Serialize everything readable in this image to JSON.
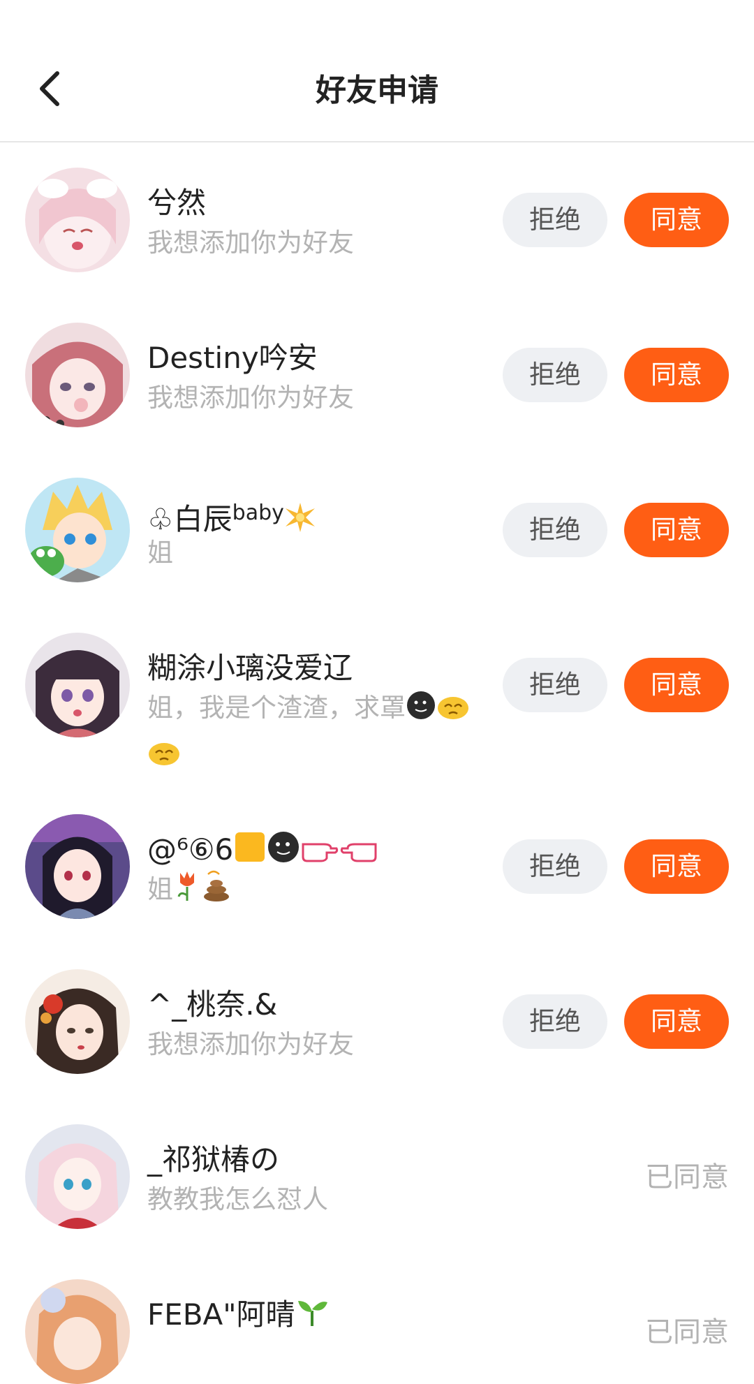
{
  "header": {
    "title": "好友申请",
    "back_icon": "chevron-left-icon"
  },
  "colors": {
    "accent": "#ff5e14",
    "reject_bg": "#eef0f3",
    "muted_text": "#b3b3b3"
  },
  "requests": [
    {
      "name": "兮然",
      "message": "我想添加你为好友",
      "reject_label": "拒绝",
      "accept_label": "同意"
    },
    {
      "name": "Destiny吟安",
      "message": "我想添加你为好友",
      "reject_label": "拒绝",
      "accept_label": "同意"
    },
    {
      "name_prefix": "♧白辰",
      "name_sup": "baby",
      "name_emoji": "star-burst-emoji",
      "message": "姐",
      "reject_label": "拒绝",
      "accept_label": "同意"
    },
    {
      "name": "糊涂小璃没爱辽",
      "message": "姐，我是个渣渣，求罩",
      "message_emojis": [
        "moon-face-emoji",
        "begging-hands-emoji",
        "begging-hands-emoji"
      ],
      "reject_label": "拒绝",
      "accept_label": "同意"
    },
    {
      "name": "@⁶⑥6",
      "name_emojis": [
        "yellow-square-emoji",
        "moon-face-emoji",
        "pointing-hand-emoji",
        "pointing-hand-emoji"
      ],
      "message": "姐",
      "message_emojis": [
        "tulip-emoji",
        "poop-emoji"
      ],
      "reject_label": "拒绝",
      "accept_label": "同意"
    },
    {
      "name": "^_桃奈.&",
      "message": "我想添加你为好友",
      "reject_label": "拒绝",
      "accept_label": "同意"
    },
    {
      "name": "_祁狱椿の",
      "message": "教教我怎么怼人",
      "status": "已同意"
    },
    {
      "name": "FEBA\"阿晴",
      "name_emoji": "seedling-emoji",
      "status": "已同意"
    }
  ]
}
